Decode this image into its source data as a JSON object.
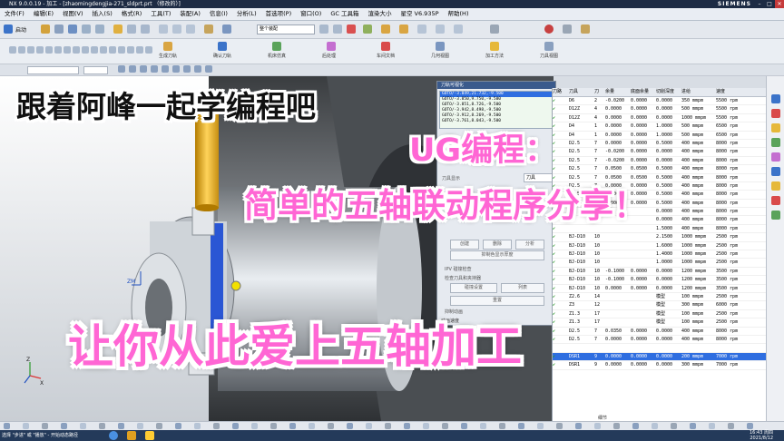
{
  "window": {
    "title": "NX 9.0.0.19 - 加工 - [zhaomingdengjia-271_sldprt.prt （修改的）]",
    "brand": "SIEMENS"
  },
  "menubar": [
    "文件(F)",
    "编辑(E)",
    "视图(V)",
    "插入(S)",
    "格式(R)",
    "工具(T)",
    "装配(A)",
    "信息(I)",
    "分析(L)",
    "首选项(P)",
    "窗口(O)",
    "GC 工具箱",
    "渲染大小",
    "星空 V6.935P",
    "帮助(H)"
  ],
  "toolbar": {
    "start_label": "启动",
    "filter_value": "整个装配",
    "buttons": [
      "生成刀轨",
      "确认刀轨",
      "机床仿真",
      "后处理",
      "车间文档",
      "几何视图",
      "加工方法",
      "刀具视图"
    ]
  },
  "captions": {
    "line1": "跟着阿峰一起学编程吧",
    "line2": "UG编程：",
    "line3": "简单的五轴联动程序分享！",
    "line4": "让你从此爱上五轴加工"
  },
  "dialog": {
    "title": "刀轨可视化",
    "list": [
      "GOTO/-3.849,21.732,-9.500",
      "GOTO/-3.850,9.750,-9.500",
      "GOTO/-3.851,8.726,-9.500",
      "GOTO/-3.942,8.498,-9.500",
      "GOTO/-3.912,8.269,-9.500",
      "GOTO/-3.761,8.043,-9.500"
    ],
    "section_label": "刀具显示",
    "section_value": "刀具",
    "buttons": [
      "创建",
      "删除",
      "分析",
      "抑制色显示厚度",
      "IPV 碰撞检查",
      "检查刀具和夹持器",
      "碰撞设置",
      "列表",
      "重置",
      "抑制动画"
    ],
    "speed_label": "动画速度"
  },
  "table": {
    "columns": [
      "刀路",
      "刀具",
      "刀",
      "余量",
      "底面余量",
      "切削深度",
      "进给",
      "速度"
    ],
    "rows": [
      [
        "✔",
        "D6",
        "2",
        "-0.0200",
        "0.0000",
        "0.0000",
        "350 mmpm",
        "5500 rpm"
      ],
      [
        "✔",
        "D12Z",
        "4",
        "0.0000",
        "0.0000",
        "0.0000",
        "500 mmpm",
        "5500 rpm"
      ],
      [
        "✔",
        "D12Z",
        "4",
        "0.0000",
        "0.0000",
        "0.0000",
        "1000 mmpm",
        "5500 rpm"
      ],
      [
        "✔",
        "D4",
        "1",
        "0.0000",
        "0.0000",
        "1.0000",
        "500 mmpm",
        "6500 rpm"
      ],
      [
        "✔",
        "D4",
        "1",
        "0.0000",
        "0.0000",
        "1.0000",
        "500 mmpm",
        "6500 rpm"
      ],
      [
        "✔",
        "D2.5",
        "7",
        "0.0000",
        "0.0000",
        "0.5000",
        "400 mmpm",
        "8000 rpm"
      ],
      [
        "✔",
        "D2.5",
        "7",
        "-0.0200",
        "0.0000",
        "0.0000",
        "400 mmpm",
        "8000 rpm"
      ],
      [
        "✔",
        "D2.5",
        "7",
        "-0.0200",
        "0.0000",
        "0.0000",
        "400 mmpm",
        "8000 rpm"
      ],
      [
        "✔",
        "D2.5",
        "7",
        "0.0500",
        "0.0500",
        "0.5000",
        "400 mmpm",
        "8000 rpm"
      ],
      [
        "✔",
        "D2.5",
        "7",
        "0.0500",
        "0.0500",
        "0.5000",
        "400 mmpm",
        "8000 rpm"
      ],
      [
        "✔",
        "D2.5",
        "7",
        "0.0000",
        "0.0000",
        "0.5000",
        "400 mmpm",
        "8000 rpm"
      ],
      [
        "✔",
        "D2.5",
        "7",
        "0.0000",
        "0.0000",
        "0.5000",
        "400 mmpm",
        "8000 rpm"
      ],
      [
        "✔",
        "D2.5",
        "7",
        "0.0000",
        "0.0000",
        "0.5000",
        "400 mmpm",
        "8000 rpm"
      ],
      [
        "✔",
        "",
        "",
        "",
        "",
        "0.0000",
        "400 mmpm",
        "8000 rpm"
      ],
      [
        "✔",
        "",
        "",
        "",
        "",
        "0.0000",
        "400 mmpm",
        "8000 rpm"
      ],
      [
        "✔",
        "",
        "",
        "",
        "",
        "1.5000",
        "400 mmpm",
        "8000 rpm"
      ],
      [
        "✔",
        "BJ-D10",
        "10",
        "",
        "",
        "2.1500",
        "1000 mmpm",
        "2500 rpm"
      ],
      [
        "✔",
        "BJ-D10",
        "10",
        "",
        "",
        "1.6000",
        "1000 mmpm",
        "2500 rpm"
      ],
      [
        "✔",
        "BJ-D10",
        "10",
        "",
        "",
        "1.4000",
        "1000 mmpm",
        "2500 rpm"
      ],
      [
        "✔",
        "BJ-D10",
        "10",
        "",
        "",
        "1.0000",
        "1000 mmpm",
        "2500 rpm"
      ],
      [
        "✔",
        "BJ-D10",
        "10",
        "-0.1000",
        "0.0000",
        "0.0000",
        "1200 mmpm",
        "3500 rpm"
      ],
      [
        "✔",
        "BJ-D10",
        "10",
        "-0.1000",
        "0.0000",
        "0.0000",
        "1200 mmpm",
        "3500 rpm"
      ],
      [
        "✔",
        "BJ-D10",
        "10",
        "0.0000",
        "0.0000",
        "0.0000",
        "1200 mmpm",
        "3500 rpm"
      ],
      [
        "✔",
        "Z2.6",
        "14",
        "",
        "",
        "模型",
        "100 mmpm",
        "2500 rpm"
      ],
      [
        "✔",
        "Z3",
        "12",
        "",
        "",
        "模型",
        "300 mmpm",
        "6000 rpm"
      ],
      [
        "✔",
        "Z1.3",
        "17",
        "",
        "",
        "模型",
        "100 mmpm",
        "2500 rpm"
      ],
      [
        "✔",
        "Z1.3",
        "17",
        "",
        "",
        "模型",
        "100 mmpm",
        "2500 rpm"
      ],
      [
        "✔",
        "D2.5",
        "7",
        "0.0350",
        "0.0000",
        "0.0000",
        "400 mmpm",
        "8000 rpm"
      ],
      [
        "✔",
        "D2.5",
        "7",
        "0.0000",
        "0.0000",
        "0.0000",
        "400 mmpm",
        "8000 rpm"
      ],
      [
        "",
        "",
        "",
        "",
        "",
        "",
        "",
        ""
      ],
      [
        "✔",
        "DSR1",
        "9",
        "0.0000",
        "0.0000",
        "0.0000",
        "200 mmpm",
        "7000 rpm"
      ],
      [
        "✔",
        "DSR1",
        "9",
        "0.0000",
        "0.0000",
        "0.0000",
        "300 mmpm",
        "7000 rpm"
      ]
    ],
    "details_label": "细节"
  },
  "status": {
    "prompt": "选择 \"步进\" 或 \"播放\" - 开始动态路径",
    "time": "16:43 周四",
    "date": "2021/8/12"
  },
  "axis": {
    "zm": "ZM",
    "z": "Z",
    "x": "X"
  }
}
